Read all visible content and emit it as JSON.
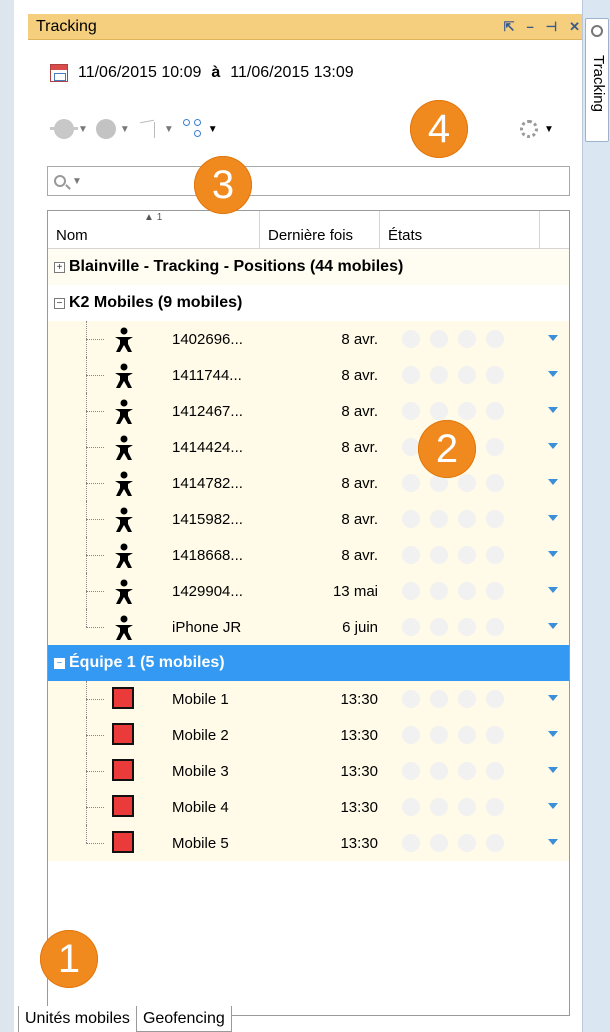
{
  "panel": {
    "title": "Tracking",
    "controls": [
      "⇱",
      "–",
      "⊣",
      "✕"
    ]
  },
  "date_range": {
    "start": "11/06/2015  10:09",
    "separator": "à",
    "end": "11/06/2015  13:09"
  },
  "toolbar": {
    "icons": [
      "globe-icon",
      "circle-icon",
      "path-icon",
      "network-icon",
      "gear-icon"
    ]
  },
  "search": {
    "placeholder": ""
  },
  "grid": {
    "columns": [
      {
        "label": "Nom",
        "sort": "1"
      },
      {
        "label": "Dernière fois"
      },
      {
        "label": "États"
      }
    ],
    "groups": [
      {
        "name": "Blainville - Tracking - Positions (44 mobiles)",
        "expanded": false,
        "items": []
      },
      {
        "name": "K2 Mobiles (9 mobiles)",
        "expanded": true,
        "items": [
          {
            "name": "1402696...",
            "time": "8 avr.",
            "icon": "person-icon"
          },
          {
            "name": "1411744...",
            "time": "8 avr.",
            "icon": "person-icon"
          },
          {
            "name": "1412467...",
            "time": "8 avr.",
            "icon": "person-icon"
          },
          {
            "name": "1414424...",
            "time": "8 avr.",
            "icon": "person-icon"
          },
          {
            "name": "1414782...",
            "time": "8 avr.",
            "icon": "person-icon"
          },
          {
            "name": "1415982...",
            "time": "8 avr.",
            "icon": "person-icon"
          },
          {
            "name": "1418668...",
            "time": "8 avr.",
            "icon": "person-icon"
          },
          {
            "name": "1429904...",
            "time": "13 mai",
            "icon": "person-icon"
          },
          {
            "name": "iPhone JR",
            "time": "6 juin",
            "icon": "person-icon"
          }
        ]
      },
      {
        "name": "Équipe 1 (5 mobiles)",
        "expanded": true,
        "selected": true,
        "items": [
          {
            "name": "Mobile 1",
            "time": "13:30",
            "icon": "red-square-icon"
          },
          {
            "name": "Mobile 2",
            "time": "13:30",
            "icon": "red-square-icon"
          },
          {
            "name": "Mobile 3",
            "time": "13:30",
            "icon": "red-square-icon"
          },
          {
            "name": "Mobile 4",
            "time": "13:30",
            "icon": "red-square-icon"
          },
          {
            "name": "Mobile 5",
            "time": "13:30",
            "icon": "red-square-icon"
          }
        ]
      }
    ]
  },
  "callouts": [
    "1",
    "2",
    "3",
    "4"
  ],
  "tabs": [
    "Unités mobiles",
    "Geofencing"
  ],
  "sidebar": {
    "tab_label": "Tracking"
  },
  "colors": {
    "title_bar": "#f5cf7e",
    "selection": "#3399f3",
    "callout": "#f08a1e",
    "status_dropdown": "#3a8fd8"
  }
}
